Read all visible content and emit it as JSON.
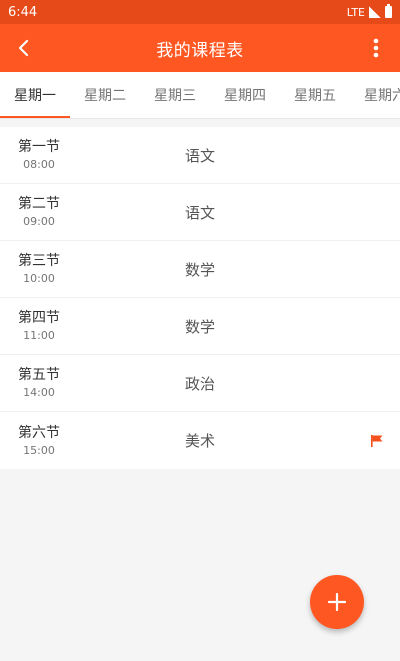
{
  "status_bar": {
    "time": "6:44",
    "network": "LTE"
  },
  "toolbar": {
    "title": "我的课程表"
  },
  "tabs": [
    {
      "label": "星期一",
      "active": true
    },
    {
      "label": "星期二",
      "active": false
    },
    {
      "label": "星期三",
      "active": false
    },
    {
      "label": "星期四",
      "active": false
    },
    {
      "label": "星期五",
      "active": false
    },
    {
      "label": "星期六",
      "active": false
    }
  ],
  "schedule": [
    {
      "period": "第一节",
      "time": "08:00",
      "course": "语文",
      "flagged": false
    },
    {
      "period": "第二节",
      "time": "09:00",
      "course": "语文",
      "flagged": false
    },
    {
      "period": "第三节",
      "time": "10:00",
      "course": "数学",
      "flagged": false
    },
    {
      "period": "第四节",
      "time": "11:00",
      "course": "数学",
      "flagged": false
    },
    {
      "period": "第五节",
      "time": "14:00",
      "course": "政治",
      "flagged": false
    },
    {
      "period": "第六节",
      "time": "15:00",
      "course": "美术",
      "flagged": true
    }
  ],
  "colors": {
    "primary": "#ff5722",
    "primary_dark": "#e64a19",
    "flag": "#f4511e"
  }
}
